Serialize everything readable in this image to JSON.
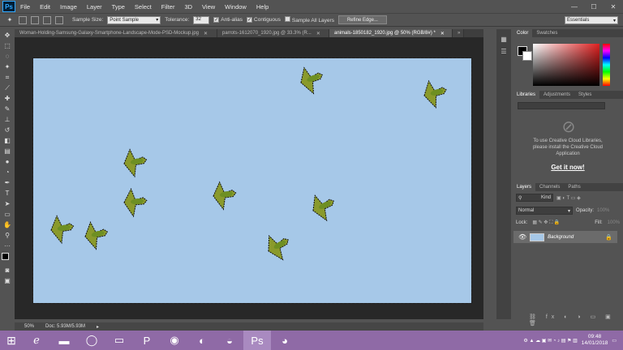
{
  "app": {
    "logo": "Ps"
  },
  "menu": [
    "File",
    "Edit",
    "Image",
    "Layer",
    "Type",
    "Select",
    "Filter",
    "3D",
    "View",
    "Window",
    "Help"
  ],
  "window_controls": {
    "minimize": "—",
    "maximize": "☐",
    "close": "✕"
  },
  "options": {
    "sample_size_label": "Sample Size:",
    "sample_size_value": "Point Sample",
    "tolerance_label": "Tolerance:",
    "tolerance_value": "32",
    "anti_alias_label": "Anti-alias",
    "contiguous_label": "Contiguous",
    "sample_all_layers_label": "Sample All Layers",
    "refine_edge_label": "Refine Edge...",
    "workspace": "Essentials"
  },
  "tabs": [
    {
      "label": "Woman-Holding-Samsung-Galaxy-Smartphone-Landscape-Mode-PSD-Mockup.jpg",
      "close": "✕"
    },
    {
      "label": "parrots-1612070_1920.jpg @ 33.3% (R...",
      "close": "✕"
    },
    {
      "label": "animals-1850182_1920.jpg @ 50% (RGB/8#) *",
      "close": "✕"
    },
    {
      "label": "»",
      "close": ""
    }
  ],
  "status": {
    "zoom": "50%",
    "doc": "Doc: 5.93M/5.93M"
  },
  "color_panel": {
    "tab_color": "Color",
    "tab_swatches": "Swatches"
  },
  "libraries_panel": {
    "tab_libraries": "Libraries",
    "tab_adjustments": "Adjustments",
    "tab_styles": "Styles",
    "message": "To use Creative Cloud Libraries, please install the Creative Cloud Application",
    "cta": "Get it now!"
  },
  "layers_panel": {
    "tab_layers": "Layers",
    "tab_channels": "Channels",
    "tab_paths": "Paths",
    "filter_kind": "Kind",
    "blend_mode": "Normal",
    "opacity_label": "Opacity:",
    "opacity_value": "100%",
    "lock_label": "Lock:",
    "fill_label": "Fill:",
    "fill_value": "100%",
    "layer_name": "Background"
  },
  "taskbar": {
    "start_icon": "windows-start-icon",
    "time": "09:48",
    "date": "14/01/2018"
  },
  "colors": {
    "sky": "#a6c8e8",
    "taskbar": "#8f6aa6",
    "ui_gray": "#535353",
    "canvas_bg": "#282828"
  }
}
